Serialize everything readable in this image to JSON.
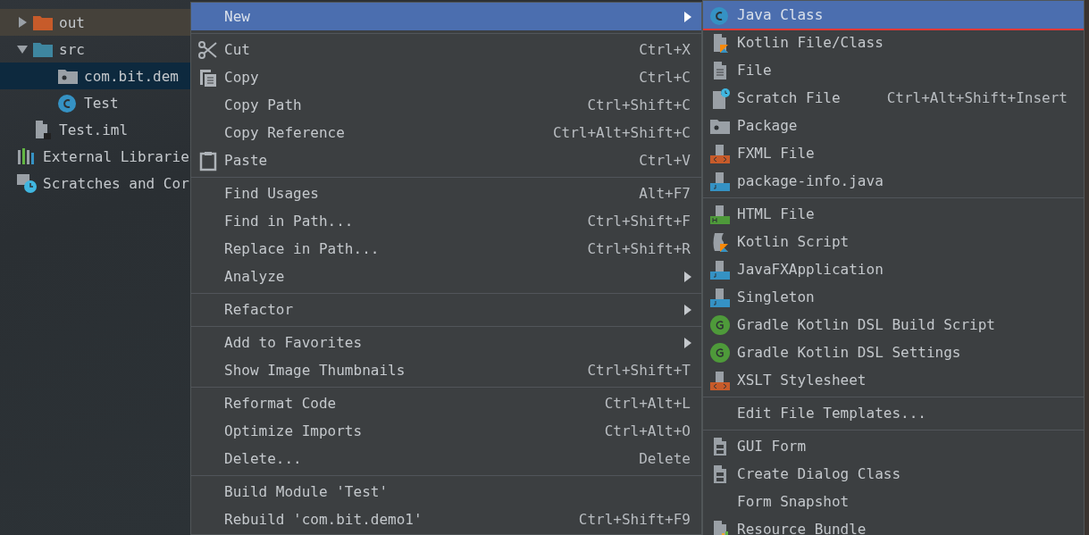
{
  "project_tree": {
    "items": [
      {
        "label": "out",
        "kind": "folder-orange",
        "expanded": false,
        "selected": false,
        "highlighted": true
      },
      {
        "label": "src",
        "kind": "folder-blue",
        "expanded": true,
        "selected": false,
        "highlighted": false,
        "children": [
          {
            "label": "com.bit.dem",
            "kind": "package",
            "selected": true,
            "highlighted": false
          },
          {
            "label": "Test",
            "kind": "java-class",
            "selected": false,
            "highlighted": false
          }
        ]
      },
      {
        "label": "Test.iml",
        "kind": "module-file",
        "selected": false,
        "highlighted": false
      }
    ],
    "root_items": [
      {
        "label": "External Librarie",
        "kind": "libraries",
        "selected": false,
        "highlighted": false
      },
      {
        "label": "Scratches and Cor",
        "kind": "scratches",
        "selected": false,
        "highlighted": false
      }
    ]
  },
  "context_menu": {
    "groups": [
      [
        {
          "label": "New",
          "selected": true,
          "submenu": true
        }
      ],
      [
        {
          "label": "Cut",
          "shortcut": "Ctrl+X",
          "kind": "scissors",
          "selected": false
        },
        {
          "label": "Copy",
          "shortcut": "Ctrl+C",
          "kind": "copy",
          "selected": false
        },
        {
          "label": "Copy Path",
          "shortcut": "Ctrl+Shift+C",
          "selected": false
        },
        {
          "label": "Copy Reference",
          "shortcut": "Ctrl+Alt+Shift+C",
          "selected": false
        },
        {
          "label": "Paste",
          "shortcut": "Ctrl+V",
          "kind": "clipboard",
          "selected": false
        }
      ],
      [
        {
          "label": "Find Usages",
          "shortcut": "Alt+F7",
          "selected": false
        },
        {
          "label": "Find in Path...",
          "shortcut": "Ctrl+Shift+F",
          "selected": false
        },
        {
          "label": "Replace in Path...",
          "shortcut": "Ctrl+Shift+R",
          "selected": false
        },
        {
          "label": "Analyze",
          "selected": false,
          "submenu": true
        }
      ],
      [
        {
          "label": "Refactor",
          "selected": false,
          "submenu": true
        }
      ],
      [
        {
          "label": "Add to Favorites",
          "selected": false,
          "submenu": true
        },
        {
          "label": "Show Image Thumbnails",
          "shortcut": "Ctrl+Shift+T",
          "selected": false
        }
      ],
      [
        {
          "label": "Reformat Code",
          "shortcut": "Ctrl+Alt+L",
          "selected": false
        },
        {
          "label": "Optimize Imports",
          "shortcut": "Ctrl+Alt+O",
          "selected": false
        },
        {
          "label": "Delete...",
          "shortcut": "Delete",
          "selected": false
        }
      ],
      [
        {
          "label": "Build Module 'Test'",
          "selected": false
        },
        {
          "label": "Rebuild 'com.bit.demo1'",
          "shortcut": "Ctrl+Shift+F9",
          "selected": false
        }
      ]
    ]
  },
  "new_submenu": {
    "groups": [
      [
        {
          "label": "Java Class",
          "kind": "java-class",
          "selected": true,
          "outlined": true
        },
        {
          "label": "Kotlin File/Class",
          "kind": "kotlin-file",
          "selected": false
        },
        {
          "label": "File",
          "kind": "file",
          "selected": false
        },
        {
          "label": "Scratch File",
          "shortcut": "Ctrl+Alt+Shift+Insert",
          "kind": "scratch-file",
          "selected": false
        },
        {
          "label": "Package",
          "kind": "package",
          "selected": false
        },
        {
          "label": "FXML File",
          "kind": "xml-file",
          "selected": false
        },
        {
          "label": "package-info.java",
          "kind": "java-file",
          "selected": false
        }
      ],
      [
        {
          "label": "HTML File",
          "kind": "html-file",
          "selected": false
        },
        {
          "label": "Kotlin Script",
          "kind": "kotlin-script",
          "selected": false
        },
        {
          "label": "JavaFXApplication",
          "kind": "java-file",
          "selected": false
        },
        {
          "label": "Singleton",
          "kind": "java-file",
          "selected": false
        },
        {
          "label": "Gradle Kotlin DSL Build Script",
          "kind": "gradle",
          "selected": false
        },
        {
          "label": "Gradle Kotlin DSL Settings",
          "kind": "gradle",
          "selected": false
        },
        {
          "label": "XSLT Stylesheet",
          "kind": "xml-file",
          "selected": false
        }
      ],
      [
        {
          "label": "Edit File Templates...",
          "selected": false
        }
      ],
      [
        {
          "label": "GUI Form",
          "kind": "form",
          "selected": false
        },
        {
          "label": "Create Dialog Class",
          "kind": "form",
          "selected": false
        },
        {
          "label": "Form Snapshot",
          "selected": false
        },
        {
          "label": "Resource Bundle",
          "kind": "bundle",
          "selected": false
        }
      ]
    ]
  }
}
